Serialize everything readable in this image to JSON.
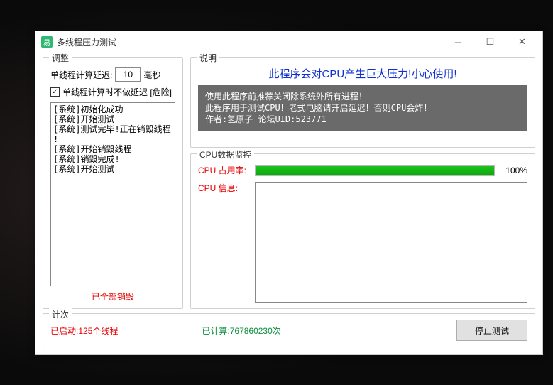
{
  "window": {
    "title": "多线程压力测试"
  },
  "adjust": {
    "group_label": "调整",
    "delay_prefix": "单线程计算延迟:",
    "delay_value": "10",
    "delay_suffix": "毫秒",
    "checkbox_label": "单线程计算时不做延迟 [危险]",
    "checkbox_checked": "✓",
    "log": "[系统]初始化成功\n[系统]开始测试\n[系统]测试完毕!正在销毁线程\n!\n[系统]开始销毁线程\n[系统]销毁完成!\n[系统]开始测试",
    "destroy_status": "已全部销毁"
  },
  "desc": {
    "group_label": "说明",
    "title": "此程序会对CPU产生巨大压力!小心使用!",
    "body": "使用此程序前推荐关闭除系统外所有进程！\n此程序用于测试CPU！老式电脑请开启延迟！否则CPU会炸！\n作者:氢原子 论坛UID:523771"
  },
  "cpu": {
    "group_label": "CPU数据监控",
    "usage_label": "CPU 占用率:",
    "usage_pct_text": "100%",
    "usage_pct_width": "100%",
    "info_label": "CPU 信息:"
  },
  "count": {
    "group_label": "计次",
    "started_prefix": "已启动:",
    "started_value": "125个线程",
    "calc_prefix": "已计算:",
    "calc_value": "767860230次",
    "stop_button": "停止测试"
  }
}
